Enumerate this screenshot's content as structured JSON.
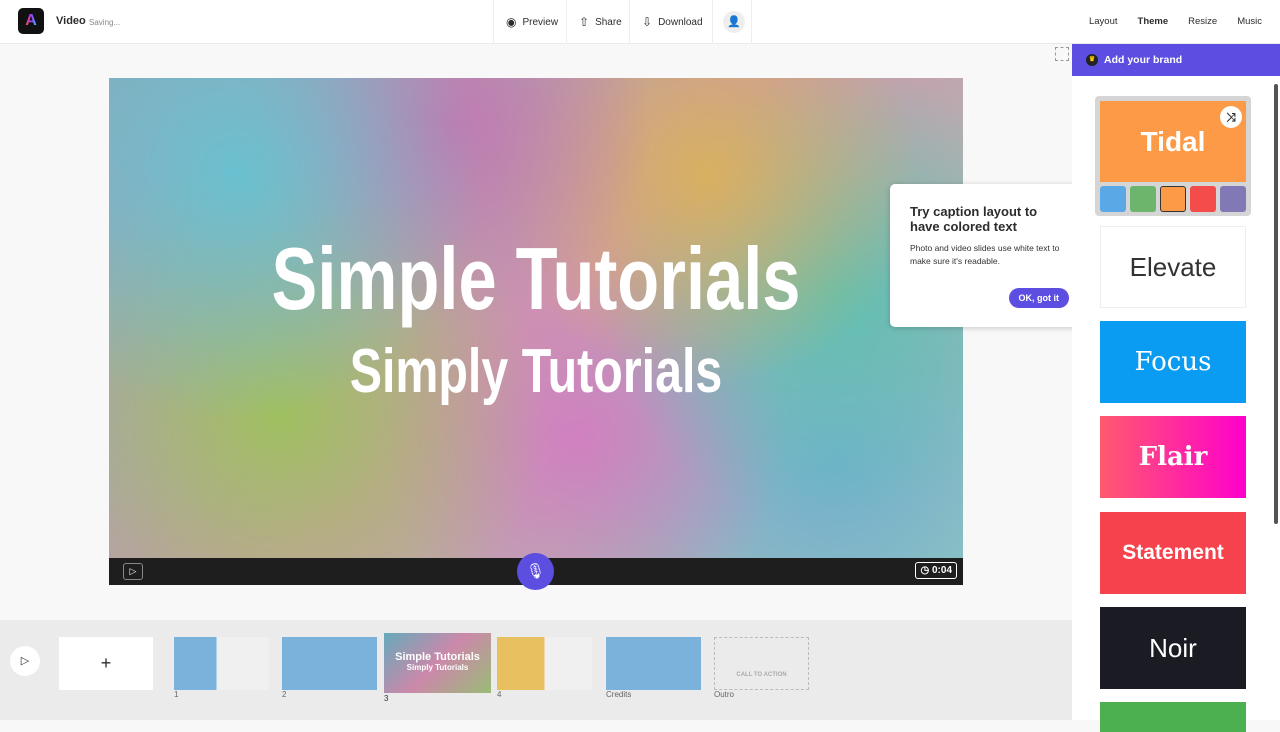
{
  "header": {
    "logo": "A",
    "title": "Video",
    "status": "Saving...",
    "preview": "Preview",
    "share": "Share",
    "download": "Download",
    "right_tabs": [
      "Layout",
      "Theme",
      "Resize",
      "Music"
    ],
    "active_tab": "Theme"
  },
  "stage": {
    "title": "Simple Tutorials",
    "subtitle": "Simply Tutorials",
    "duration": "0:04"
  },
  "tooltip": {
    "title": "Try caption layout to have colored text",
    "body": "Photo and video slides use white text to make sure it's readable.",
    "button": "OK, got it"
  },
  "panel": {
    "brand": "Add your brand",
    "themes": [
      "Tidal",
      "Elevate",
      "Focus",
      "Flair",
      "Statement",
      "Noir"
    ],
    "swatches": [
      "#5aa9e6",
      "#6db56d",
      "#fd9a48",
      "#f44b4b",
      "#8079b5"
    ]
  },
  "timeline": {
    "add": "+",
    "slides": [
      "1",
      "2",
      "3",
      "4",
      "Credits",
      "Outro"
    ],
    "thumb3_title": "Simple Tutorials",
    "thumb3_sub": "Simply Tutorials",
    "cta": "CALL TO ACTION"
  }
}
